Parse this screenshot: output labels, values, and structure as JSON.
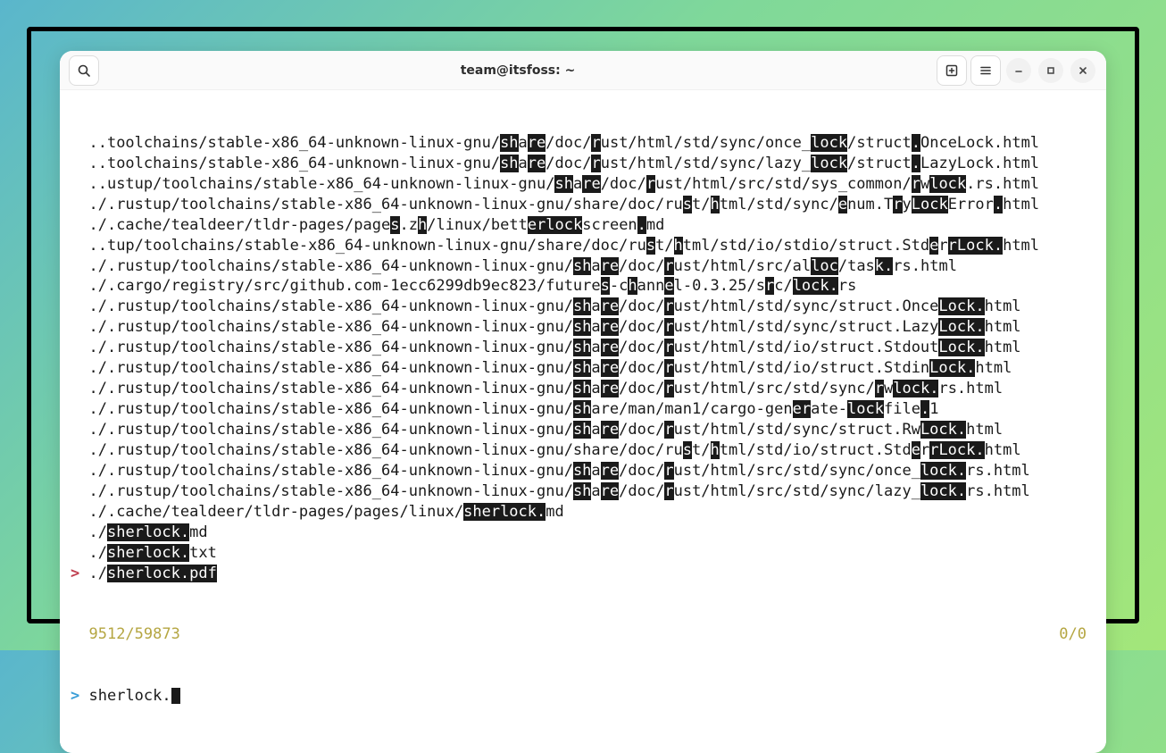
{
  "titlebar": {
    "title": "team@itsfoss: ~"
  },
  "lines": [
    {
      "prefix": "  ",
      "segs": [
        [
          "..toolchains/stable-x86_64-unknown-linux-gnu/",
          0
        ],
        [
          "sh",
          1
        ],
        [
          "a",
          0
        ],
        [
          "re",
          1
        ],
        [
          "/doc/",
          0
        ],
        [
          "r",
          1
        ],
        [
          "ust/html/std/sync/once_",
          0
        ],
        [
          "lock",
          1
        ],
        [
          "/struct",
          0
        ],
        [
          ".",
          1
        ],
        [
          "OnceLock.html",
          0
        ]
      ]
    },
    {
      "prefix": "  ",
      "segs": [
        [
          "..toolchains/stable-x86_64-unknown-linux-gnu/",
          0
        ],
        [
          "sh",
          1
        ],
        [
          "a",
          0
        ],
        [
          "re",
          1
        ],
        [
          "/doc/",
          0
        ],
        [
          "r",
          1
        ],
        [
          "ust/html/std/sync/lazy_",
          0
        ],
        [
          "lock",
          1
        ],
        [
          "/struct",
          0
        ],
        [
          ".",
          1
        ],
        [
          "LazyLock.html",
          0
        ]
      ]
    },
    {
      "prefix": "  ",
      "segs": [
        [
          "..ustup/toolchains/stable-x86_64-unknown-linux-gnu/",
          0
        ],
        [
          "sh",
          1
        ],
        [
          "a",
          0
        ],
        [
          "re",
          1
        ],
        [
          "/doc/",
          0
        ],
        [
          "r",
          1
        ],
        [
          "ust/html/src/std/sys_common/",
          0
        ],
        [
          "r",
          1
        ],
        [
          "w",
          0
        ],
        [
          "lock",
          1
        ],
        [
          ".rs.html",
          0
        ]
      ]
    },
    {
      "prefix": "  ",
      "segs": [
        [
          "./.rustup/toolchains/stable-x86_64-unknown-linux-gnu/share/doc/ru",
          0
        ],
        [
          "s",
          1
        ],
        [
          "t/",
          0
        ],
        [
          "h",
          1
        ],
        [
          "tml/std/sync/",
          0
        ],
        [
          "e",
          1
        ],
        [
          "num.T",
          0
        ],
        [
          "r",
          1
        ],
        [
          "y",
          0
        ],
        [
          "Lock",
          1
        ],
        [
          "Error",
          0
        ],
        [
          ".",
          1
        ],
        [
          "html",
          0
        ]
      ]
    },
    {
      "prefix": "  ",
      "segs": [
        [
          "./.cache/tealdeer/tldr-pages/page",
          0
        ],
        [
          "s",
          1
        ],
        [
          ".z",
          0
        ],
        [
          "h",
          1
        ],
        [
          "/linux/bett",
          0
        ],
        [
          "erlock",
          1
        ],
        [
          "screen",
          0
        ],
        [
          ".",
          1
        ],
        [
          "md",
          0
        ]
      ]
    },
    {
      "prefix": "  ",
      "segs": [
        [
          "..tup/toolchains/stable-x86_64-unknown-linux-gnu/share/doc/ru",
          0
        ],
        [
          "s",
          1
        ],
        [
          "t/",
          0
        ],
        [
          "h",
          1
        ],
        [
          "tml/std/io/stdio/struct.Std",
          0
        ],
        [
          "e",
          1
        ],
        [
          "r",
          0
        ],
        [
          "r",
          1
        ],
        [
          "Lock.",
          1
        ],
        [
          "html",
          0
        ]
      ]
    },
    {
      "prefix": "  ",
      "segs": [
        [
          "./.rustup/toolchains/stable-x86_64-unknown-linux-gnu/",
          0
        ],
        [
          "sh",
          1
        ],
        [
          "a",
          0
        ],
        [
          "re",
          1
        ],
        [
          "/doc/",
          0
        ],
        [
          "r",
          1
        ],
        [
          "ust/html/src/al",
          0
        ],
        [
          "loc",
          1
        ],
        [
          "/tas",
          0
        ],
        [
          "k.",
          1
        ],
        [
          "rs.html",
          0
        ]
      ]
    },
    {
      "prefix": "  ",
      "segs": [
        [
          "./.cargo/registry/src/github.com-1ecc6299db9ec823/future",
          0
        ],
        [
          "s",
          1
        ],
        [
          "-c",
          0
        ],
        [
          "h",
          1
        ],
        [
          "ann",
          0
        ],
        [
          "e",
          1
        ],
        [
          "l-0.3.25/s",
          0
        ],
        [
          "r",
          1
        ],
        [
          "c/",
          0
        ],
        [
          "lock.",
          1
        ],
        [
          "rs",
          0
        ]
      ]
    },
    {
      "prefix": "  ",
      "segs": [
        [
          "./.rustup/toolchains/stable-x86_64-unknown-linux-gnu/",
          0
        ],
        [
          "sh",
          1
        ],
        [
          "a",
          0
        ],
        [
          "re",
          1
        ],
        [
          "/doc/",
          0
        ],
        [
          "r",
          1
        ],
        [
          "ust/html/std/sync/struct.Once",
          0
        ],
        [
          "Lock.",
          1
        ],
        [
          "html",
          0
        ]
      ]
    },
    {
      "prefix": "  ",
      "segs": [
        [
          "./.rustup/toolchains/stable-x86_64-unknown-linux-gnu/",
          0
        ],
        [
          "sh",
          1
        ],
        [
          "a",
          0
        ],
        [
          "re",
          1
        ],
        [
          "/doc/",
          0
        ],
        [
          "r",
          1
        ],
        [
          "ust/html/std/sync/struct.Lazy",
          0
        ],
        [
          "Lock.",
          1
        ],
        [
          "html",
          0
        ]
      ]
    },
    {
      "prefix": "  ",
      "segs": [
        [
          "./.rustup/toolchains/stable-x86_64-unknown-linux-gnu/",
          0
        ],
        [
          "sh",
          1
        ],
        [
          "a",
          0
        ],
        [
          "re",
          1
        ],
        [
          "/doc/",
          0
        ],
        [
          "r",
          1
        ],
        [
          "ust/html/std/io/struct.Stdout",
          0
        ],
        [
          "Lock.",
          1
        ],
        [
          "html",
          0
        ]
      ]
    },
    {
      "prefix": "  ",
      "segs": [
        [
          "./.rustup/toolchains/stable-x86_64-unknown-linux-gnu/",
          0
        ],
        [
          "sh",
          1
        ],
        [
          "a",
          0
        ],
        [
          "re",
          1
        ],
        [
          "/doc/",
          0
        ],
        [
          "r",
          1
        ],
        [
          "ust/html/std/io/struct.Stdin",
          0
        ],
        [
          "Lock.",
          1
        ],
        [
          "html",
          0
        ]
      ]
    },
    {
      "prefix": "  ",
      "segs": [
        [
          "./.rustup/toolchains/stable-x86_64-unknown-linux-gnu/",
          0
        ],
        [
          "sh",
          1
        ],
        [
          "a",
          0
        ],
        [
          "re",
          1
        ],
        [
          "/doc/",
          0
        ],
        [
          "r",
          1
        ],
        [
          "ust/html/src/std/sync/",
          0
        ],
        [
          "r",
          1
        ],
        [
          "w",
          0
        ],
        [
          "lock.",
          1
        ],
        [
          "rs.html",
          0
        ]
      ]
    },
    {
      "prefix": "  ",
      "segs": [
        [
          "./.rustup/toolchains/stable-x86_64-unknown-linux-gnu/",
          0
        ],
        [
          "sh",
          1
        ],
        [
          "are/man/man1/cargo-gen",
          0
        ],
        [
          "er",
          1
        ],
        [
          "ate-",
          0
        ],
        [
          "lock",
          1
        ],
        [
          "file",
          0
        ],
        [
          ".",
          1
        ],
        [
          "1",
          0
        ]
      ]
    },
    {
      "prefix": "  ",
      "segs": [
        [
          "./.rustup/toolchains/stable-x86_64-unknown-linux-gnu/",
          0
        ],
        [
          "sh",
          1
        ],
        [
          "a",
          0
        ],
        [
          "re",
          1
        ],
        [
          "/doc/",
          0
        ],
        [
          "r",
          1
        ],
        [
          "ust/html/std/sync/struct.Rw",
          0
        ],
        [
          "Lock.",
          1
        ],
        [
          "html",
          0
        ]
      ]
    },
    {
      "prefix": "  ",
      "segs": [
        [
          "./.rustup/toolchains/stable-x86_64-unknown-linux-gnu/share/doc/ru",
          0
        ],
        [
          "s",
          1
        ],
        [
          "t/",
          0
        ],
        [
          "h",
          1
        ],
        [
          "tml/std/io/struct.Std",
          0
        ],
        [
          "e",
          1
        ],
        [
          "r",
          0
        ],
        [
          "r",
          1
        ],
        [
          "Lock.",
          1
        ],
        [
          "html",
          0
        ]
      ]
    },
    {
      "prefix": "  ",
      "segs": [
        [
          "./.rustup/toolchains/stable-x86_64-unknown-linux-gnu/",
          0
        ],
        [
          "sh",
          1
        ],
        [
          "a",
          0
        ],
        [
          "re",
          1
        ],
        [
          "/doc/",
          0
        ],
        [
          "r",
          1
        ],
        [
          "ust/html/src/std/sync/once_",
          0
        ],
        [
          "lock.",
          1
        ],
        [
          "rs.html",
          0
        ]
      ]
    },
    {
      "prefix": "  ",
      "segs": [
        [
          "./.rustup/toolchains/stable-x86_64-unknown-linux-gnu/",
          0
        ],
        [
          "sh",
          1
        ],
        [
          "a",
          0
        ],
        [
          "re",
          1
        ],
        [
          "/doc/",
          0
        ],
        [
          "r",
          1
        ],
        [
          "ust/html/src/std/sync/lazy_",
          0
        ],
        [
          "lock.",
          1
        ],
        [
          "rs.html",
          0
        ]
      ]
    },
    {
      "prefix": "  ",
      "segs": [
        [
          "./.cache/tealdeer/tldr-pages/pages/linux/",
          0
        ],
        [
          "sherlock.",
          1
        ],
        [
          "md",
          0
        ]
      ]
    },
    {
      "prefix": "  ",
      "segs": [
        [
          "./",
          0
        ],
        [
          "sherlock.",
          1
        ],
        [
          "md",
          0
        ]
      ]
    },
    {
      "prefix": "  ",
      "segs": [
        [
          "./",
          0
        ],
        [
          "sherlock.",
          1
        ],
        [
          "txt",
          0
        ]
      ]
    },
    {
      "prefix": "> ",
      "selected": true,
      "segs": [
        [
          "./",
          0
        ],
        [
          "sherlock.",
          1
        ],
        [
          "pdf",
          1
        ]
      ]
    }
  ],
  "status": {
    "match_count": "9512/59873",
    "right_count": "0/0"
  },
  "prompt": {
    "symbol": ">",
    "query": "sherlock."
  }
}
